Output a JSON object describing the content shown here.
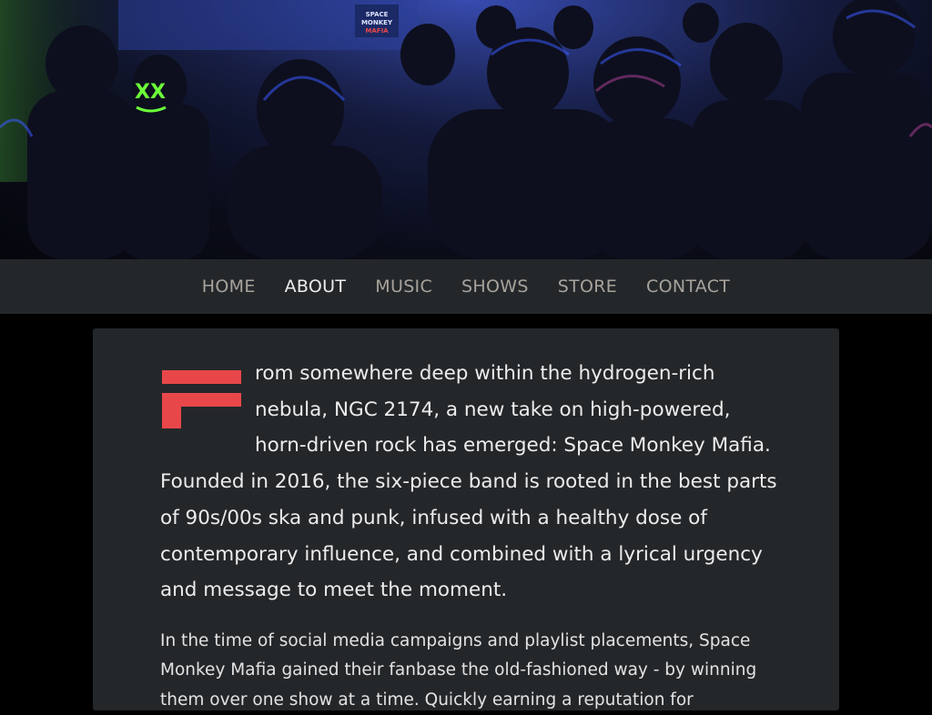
{
  "hero": {
    "image_description_icon": "concert-crowd-image",
    "stage_sign": "SPACE MONKEY MAFIA",
    "mask_text": "XX"
  },
  "nav": {
    "items": [
      {
        "label": "HOME",
        "active": false
      },
      {
        "label": "ABOUT",
        "active": true
      },
      {
        "label": "MUSIC",
        "active": false
      },
      {
        "label": "SHOWS",
        "active": false
      },
      {
        "label": "STORE",
        "active": false
      },
      {
        "label": "CONTACT",
        "active": false
      }
    ]
  },
  "about": {
    "dropcap_letter": "F",
    "dropcap_color": "#e8474a",
    "lead_text": "rom somewhere deep within the hydrogen-rich nebula, NGC 2174, a new take on high-powered, horn-driven rock has emerged: Space Monkey Mafia. Founded in 2016, the six-piece band is rooted in the best parts of 90s/00s ska and punk, infused with a healthy dose of contemporary influence, and combined with a lyrical urgency and message to meet the moment.",
    "body_text": "In the time of social media campaigns and playlist placements, Space Monkey Mafia gained their fanbase the old-fashioned way - by winning them over one show at a time. Quickly earning a reputation for"
  }
}
